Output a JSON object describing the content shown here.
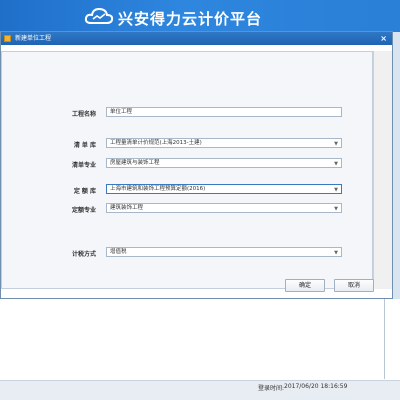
{
  "banner": {
    "title": "兴安得力云计价平台"
  },
  "dialog": {
    "title": "新建单位工程",
    "close": "×",
    "fields": {
      "project_name": {
        "label": "工程名称",
        "value": "单位工程"
      },
      "bill_library": {
        "label": "清 单 库",
        "value": "工程量清单计价规范(上海2013-土建)"
      },
      "bill_specialty": {
        "label": "清单专业",
        "value": "房屋建筑与装饰工程"
      },
      "quota_library": {
        "label": "定 额 库",
        "value": "上海市建筑和装饰工程预算定额(2016)"
      },
      "quota_specialty": {
        "label": "定额专业",
        "value": "建筑装饰工程"
      },
      "tax_method": {
        "label": "计税方式",
        "value": "增值税"
      }
    },
    "buttons": {
      "ok": "确定",
      "cancel": "取消"
    }
  },
  "status": {
    "login_label": "登录时间:",
    "login_time": "2017/06/20 18:16:59"
  }
}
